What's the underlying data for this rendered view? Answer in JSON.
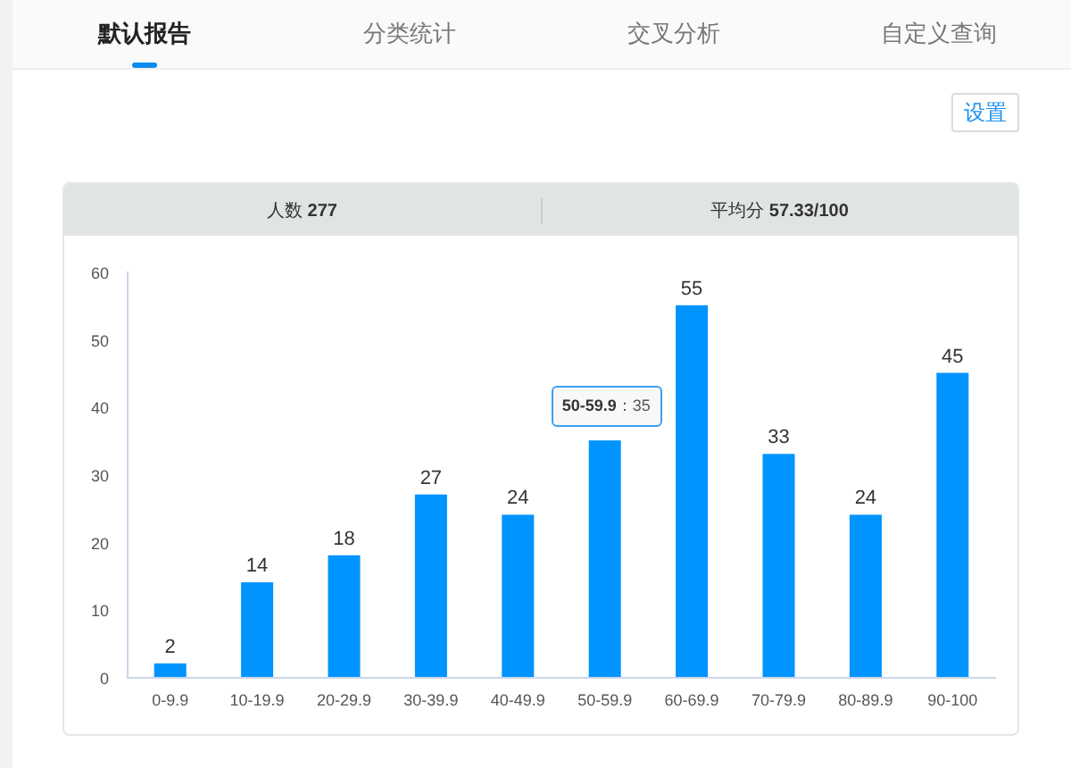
{
  "tabs": [
    {
      "label": "默认报告",
      "selected": true
    },
    {
      "label": "分类统计",
      "selected": false
    },
    {
      "label": "交叉分析",
      "selected": false
    },
    {
      "label": "自定义查询",
      "selected": false
    }
  ],
  "settings_button": "设置",
  "summary": [
    {
      "label": "人数",
      "value": "277"
    },
    {
      "label": "平均分",
      "value": "57.33/100"
    }
  ],
  "chart_data": {
    "type": "bar",
    "categories": [
      "0-9.9",
      "10-19.9",
      "20-29.9",
      "30-39.9",
      "40-49.9",
      "50-59.9",
      "60-69.9",
      "70-79.9",
      "80-89.9",
      "90-100"
    ],
    "series": [
      {
        "color": "#0094ff",
        "values": [
          2,
          14,
          18,
          27,
          24,
          35,
          55,
          33,
          24,
          45
        ]
      }
    ],
    "ylim": [
      0,
      60
    ],
    "yticks": [
      0,
      10,
      20,
      30,
      40,
      50,
      60
    ],
    "value_labels": [
      "2",
      "14",
      "18",
      "27",
      "24",
      null,
      "55",
      "33",
      "24",
      "45"
    ]
  },
  "tooltip": {
    "category": "50-59.9",
    "value": "：35"
  }
}
